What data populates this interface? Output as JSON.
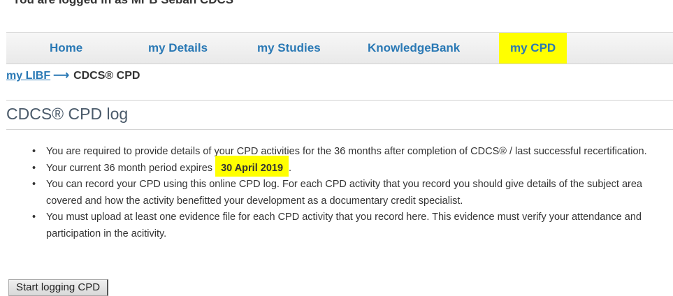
{
  "header": {
    "login_text": "You are logged in as Mr B Sebah CDCS"
  },
  "nav": {
    "items": [
      {
        "label": "Home"
      },
      {
        "label": "my Details"
      },
      {
        "label": "my Studies"
      },
      {
        "label": "KnowledgeBank"
      },
      {
        "label": "my CPD",
        "active": true
      }
    ],
    "active_highlight_color": "#ffff00",
    "link_color": "#2a79b5"
  },
  "breadcrumb": {
    "link_label": "my LIBF",
    "separator": "⟶",
    "current_label": "CDCS® CPD"
  },
  "page": {
    "title": "CDCS® CPD log"
  },
  "info": {
    "item1": "You are required to provide details of your CPD activities for the 36 months after completion of CDCS® / last successful recertification.",
    "item2_prefix": "Your current 36 month period expires ",
    "item2_date": "30 April 2019",
    "item2_suffix": ".",
    "item3": "You can record your CPD using this online CPD log. For each CPD activity that you record you should give details of the subject area covered and how the activity benefitted your development as a documentary credit specialist.",
    "item4": "You must upload at least one evidence file for each CPD activity that you record here. This evidence must verify your attendance and participation in the acitivity."
  },
  "actions": {
    "start_button_label": "Start logging CPD"
  }
}
